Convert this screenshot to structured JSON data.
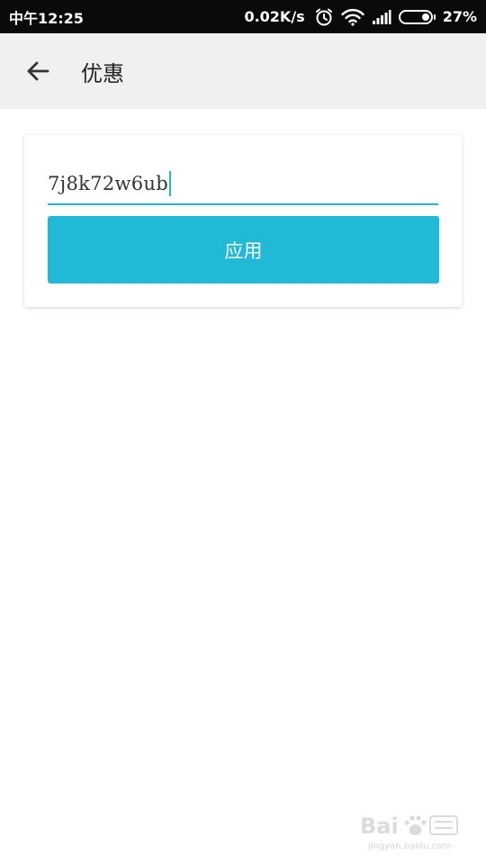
{
  "status_bar": {
    "time": "中午12:25",
    "network_speed": "0.02K/s",
    "battery_percent": "27%",
    "battery_level": 0.27,
    "icons": [
      "alarm-icon",
      "wifi-icon",
      "signal-icon",
      "battery-icon"
    ]
  },
  "app_bar": {
    "back_icon": "arrow-left-icon",
    "title": "优惠"
  },
  "promo": {
    "code_value": "7j8k72w6ub",
    "apply_label": "应用"
  },
  "watermark": {
    "url": "jingyan.baidu.com"
  },
  "colors": {
    "accent": "#22b9d6",
    "status_bar_bg": "#0a0a0a",
    "app_bar_bg": "#f0f0f2"
  }
}
